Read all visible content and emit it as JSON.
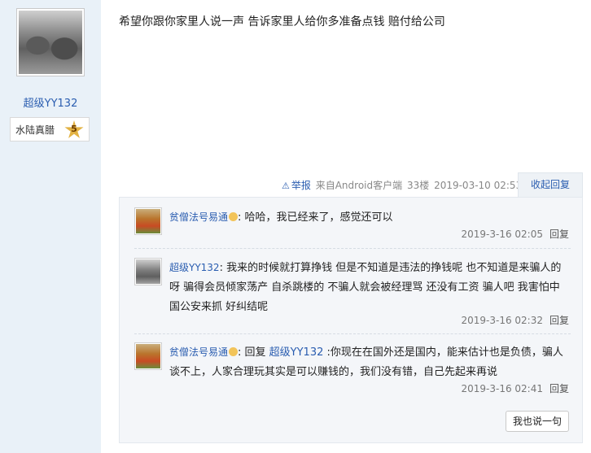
{
  "author": {
    "username": "超级YY132",
    "medal_label": "水陆真腊",
    "medal_level": "5"
  },
  "post": {
    "content": "希望你跟你家里人说一声 告诉家里人给你多准备点钱 赔付给公司",
    "report_label": "举报",
    "client": "来自Android客户端",
    "floor": "33楼",
    "timestamp": "2019-03-10 02:53",
    "reply_tab": "收起回复"
  },
  "replies": [
    {
      "user": "贫僧法号易通",
      "text": ": 哈哈，我已经来了，感觉还可以",
      "time": "2019-3-16 02:05",
      "reply_label": "回复"
    },
    {
      "user": "超级YY132",
      "text": ": 我来的时候就打算挣钱 但是不知道是违法的挣钱呢 也不知道是来骗人的呀 骗得会员倾家荡产 自杀跳楼的 不骗人就会被经理骂 还没有工资 骗人吧 我害怕中国公安来抓 好纠结呢",
      "time": "2019-3-16 02:32",
      "reply_label": "回复"
    },
    {
      "user": "贫僧法号易通",
      "prefix": ": 回复 ",
      "mention": "超级YY132",
      "text": " :你现在在国外还是国内，能来估计也是负债，骗人谈不上，人家合理玩其实是可以赚钱的，我们没有错，自己先起来再说",
      "time": "2019-3-16 02:41",
      "reply_label": "回复"
    }
  ],
  "say_button": "我也说一句",
  "colors": {
    "link": "#2a5db0",
    "sidebar_bg": "#e9f1f8",
    "panel_bg": "#f4f6f9",
    "medal": "#e2b243"
  }
}
